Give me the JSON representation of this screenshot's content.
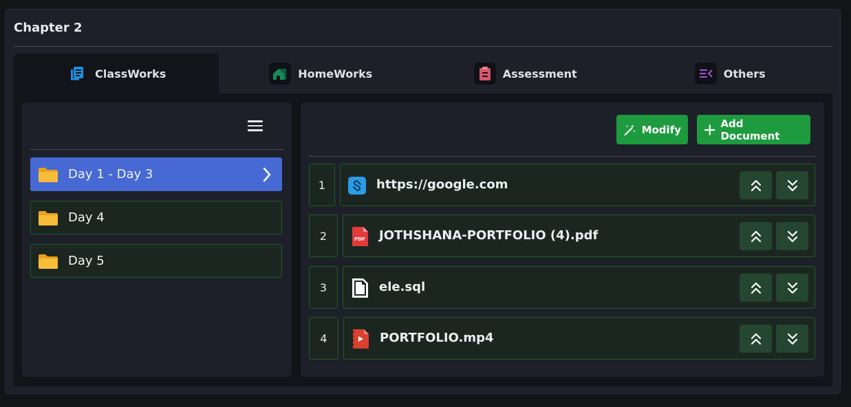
{
  "chapter": {
    "title": "Chapter 2"
  },
  "tabs": [
    {
      "label": "ClassWorks",
      "icon": "book-stack-icon",
      "color": "#1f8fde",
      "active": true
    },
    {
      "label": "HomeWorks",
      "icon": "house-icon",
      "color": "#178a5c",
      "active": false
    },
    {
      "label": "Assessment",
      "icon": "clipboard-icon",
      "color": "#d9566b",
      "active": false
    },
    {
      "label": "Others",
      "icon": "list-collapse-icon",
      "color": "#a64fd6",
      "active": false
    }
  ],
  "folders": [
    {
      "label": "Day 1 - Day 3",
      "active": true
    },
    {
      "label": "Day 4",
      "active": false
    },
    {
      "label": "Day 5",
      "active": false
    }
  ],
  "actions": {
    "modify_label": "Modify",
    "add_label": "Add Document"
  },
  "documents": [
    {
      "num": "1",
      "name": "https://google.com",
      "icon": "link-icon"
    },
    {
      "num": "2",
      "name": "JOTHSHANA-PORTFOLIO (4).pdf",
      "icon": "pdf-file-icon",
      "icon_text": "PDF"
    },
    {
      "num": "3",
      "name": "ele.sql",
      "icon": "file-icon"
    },
    {
      "num": "4",
      "name": "PORTFOLIO.mp4",
      "icon": "video-file-icon"
    }
  ],
  "colors": {
    "accent_blue": "#4669d3",
    "accent_green": "#1e9a3f",
    "row_border": "#1f5c2a"
  }
}
